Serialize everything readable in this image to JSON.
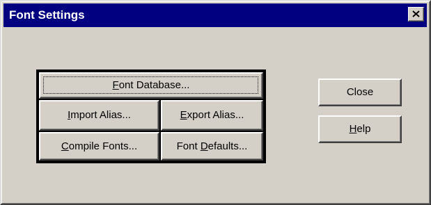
{
  "window": {
    "title": "Font Settings"
  },
  "titlebar": {
    "close_icon": "close-icon"
  },
  "font_group": {
    "font_database": {
      "label": "Font Database...",
      "mnemonic": "F"
    },
    "import_alias": {
      "label": "Import Alias...",
      "mnemonic": "I"
    },
    "export_alias": {
      "label": "Export Alias...",
      "mnemonic": "E"
    },
    "compile_fonts": {
      "label": "Compile Fonts...",
      "mnemonic": "C"
    },
    "font_defaults": {
      "label": "Font Defaults...",
      "mnemonic": "D"
    }
  },
  "side_buttons": {
    "close": {
      "label": "Close"
    },
    "help": {
      "label": "Help",
      "mnemonic": "H"
    }
  },
  "colors": {
    "titlebar_bg": "#000080",
    "titlebar_fg": "#ffffff",
    "dialog_bg": "#d4d0c8"
  }
}
